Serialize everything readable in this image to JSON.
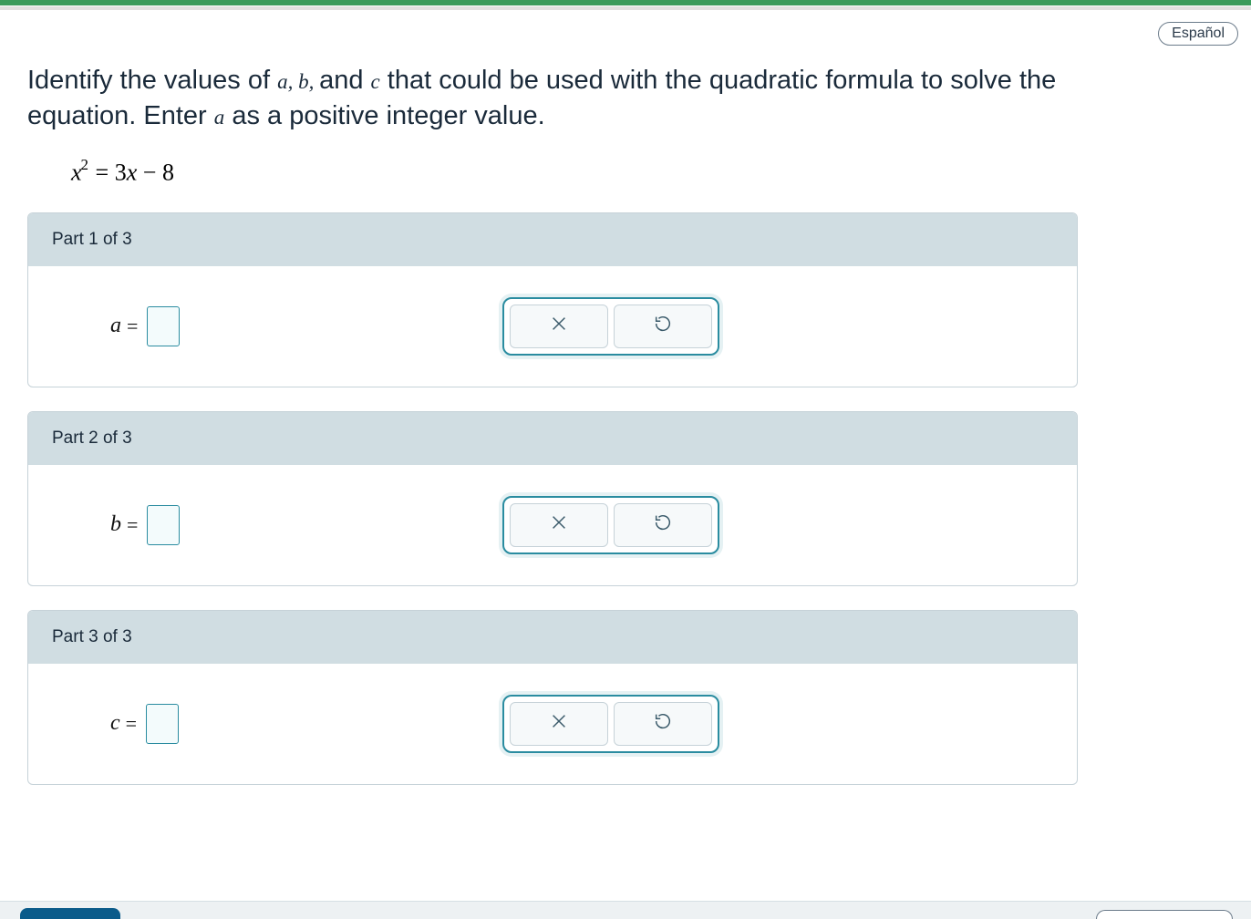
{
  "language_label": "Español",
  "prompt": {
    "seg1": "Identify the values of ",
    "var_a": "a",
    "comma1": ", ",
    "var_b": "b",
    "comma2": ", ",
    "seg2": "and ",
    "var_c": "c",
    "seg3": " that could be used with the quadratic formula to solve the equation. Enter ",
    "var_a2": "a",
    "seg4": " as a positive integer value."
  },
  "equation": {
    "lhs_var": "x",
    "lhs_exp": "2",
    "eq": " = ",
    "rhs_coeff": "3",
    "rhs_var": "x",
    "rhs_op": " − ",
    "rhs_const": "8"
  },
  "parts": [
    {
      "header": "Part 1 of 3",
      "var": "a",
      "value": ""
    },
    {
      "header": "Part 2 of 3",
      "var": "b",
      "value": ""
    },
    {
      "header": "Part 3 of 3",
      "var": "c",
      "value": ""
    }
  ],
  "icons": {
    "clear": "×",
    "reset": "↺"
  }
}
